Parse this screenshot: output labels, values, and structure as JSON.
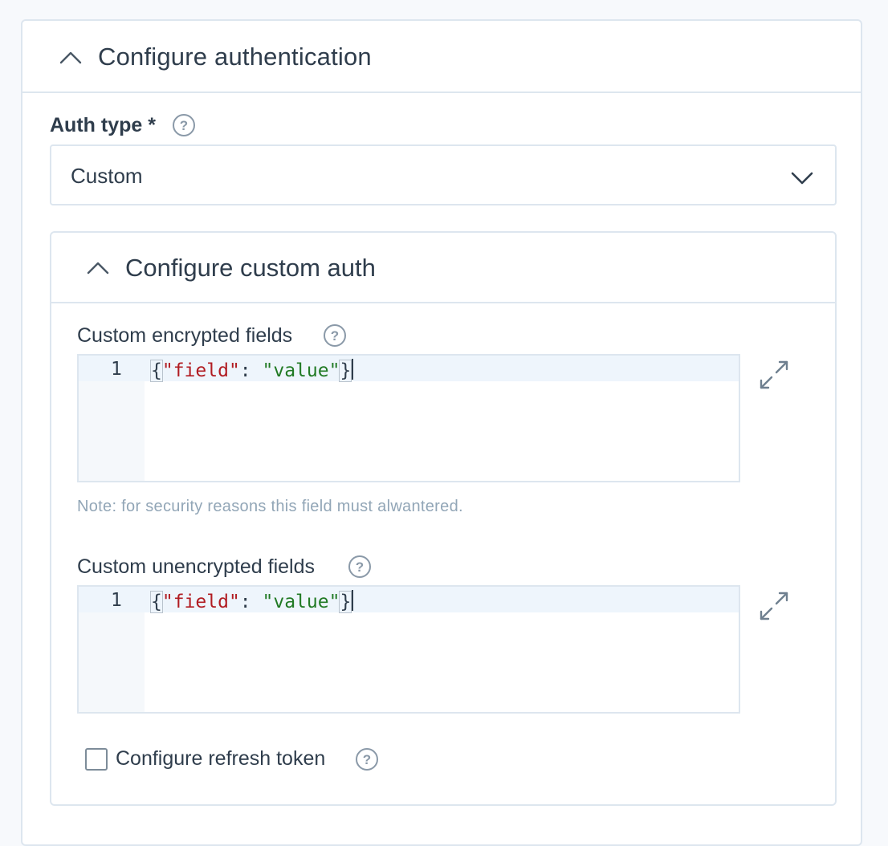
{
  "auth_section": {
    "title": "Configure authentication",
    "auth_type_label": "Auth type *",
    "auth_type_value": "Custom"
  },
  "custom_auth": {
    "title": "Configure custom auth",
    "encrypted": {
      "label": "Custom encrypted fields",
      "line_number": "1",
      "code": {
        "open": "{",
        "key": "\"field\"",
        "sep": ": ",
        "value": "\"value\"",
        "close": "}"
      },
      "note": "Note: for security reasons this field must alwantered."
    },
    "unencrypted": {
      "label": "Custom unencrypted fields",
      "line_number": "1",
      "code": {
        "open": "{",
        "key": "\"field\"",
        "sep": ": ",
        "value": "\"value\"",
        "close": "}"
      }
    },
    "refresh_token": {
      "label": "Configure refresh token",
      "checked": false
    }
  },
  "icons": {
    "collapse": "chevron-up-icon",
    "select": "chevron-down-icon",
    "help": "help-icon",
    "expand": "expand-icon"
  },
  "colors": {
    "json_key": "#b11c22",
    "json_string": "#217a24",
    "note_text": "#92a6b7",
    "border": "#dde6ef"
  }
}
